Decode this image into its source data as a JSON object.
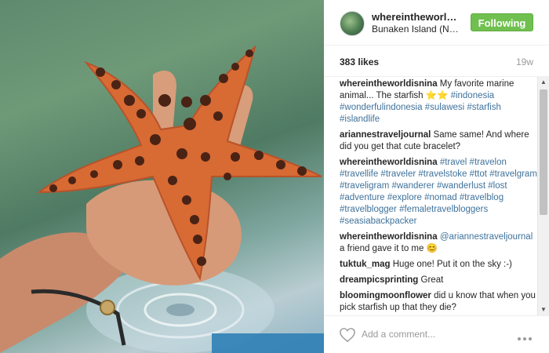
{
  "post": {
    "username": "whereintheworldisnina",
    "location": "Bunaken Island (North Sulawesi)",
    "follow_label": "Following",
    "likes": "383 likes",
    "age": "19w"
  },
  "comments": [
    {
      "user": "whereintheworldisnina",
      "parts": [
        {
          "type": "text",
          "text": " My favorite marine animal... The starfish ⭐⭐ "
        },
        {
          "type": "tag",
          "text": "#indonesia"
        },
        {
          "type": "text",
          "text": " "
        },
        {
          "type": "tag",
          "text": "#wonderfulindonesia"
        },
        {
          "type": "text",
          "text": " "
        },
        {
          "type": "tag",
          "text": "#sulawesi"
        },
        {
          "type": "text",
          "text": " "
        },
        {
          "type": "tag",
          "text": "#starfish"
        },
        {
          "type": "text",
          "text": " "
        },
        {
          "type": "tag",
          "text": "#islandlife"
        }
      ]
    },
    {
      "user": "ariannestraveljournal",
      "parts": [
        {
          "type": "text",
          "text": " Same same! And where did you get that cute bracelet?"
        }
      ]
    },
    {
      "user": "whereintheworldisnina",
      "parts": [
        {
          "type": "text",
          "text": " "
        },
        {
          "type": "tag",
          "text": "#travel"
        },
        {
          "type": "text",
          "text": " "
        },
        {
          "type": "tag",
          "text": "#travelon"
        },
        {
          "type": "text",
          "text": " "
        },
        {
          "type": "tag",
          "text": "#travellife"
        },
        {
          "type": "text",
          "text": " "
        },
        {
          "type": "tag",
          "text": "#traveler"
        },
        {
          "type": "text",
          "text": " "
        },
        {
          "type": "tag",
          "text": "#travelstoke"
        },
        {
          "type": "text",
          "text": " "
        },
        {
          "type": "tag",
          "text": "#ttot"
        },
        {
          "type": "text",
          "text": " "
        },
        {
          "type": "tag",
          "text": "#travelgram"
        },
        {
          "type": "text",
          "text": " "
        },
        {
          "type": "tag",
          "text": "#traveligram"
        },
        {
          "type": "text",
          "text": " "
        },
        {
          "type": "tag",
          "text": "#wanderer"
        },
        {
          "type": "text",
          "text": " "
        },
        {
          "type": "tag",
          "text": "#wanderlust"
        },
        {
          "type": "text",
          "text": " "
        },
        {
          "type": "tag",
          "text": "#lost"
        },
        {
          "type": "text",
          "text": " "
        },
        {
          "type": "tag",
          "text": "#adventure"
        },
        {
          "type": "text",
          "text": " "
        },
        {
          "type": "tag",
          "text": "#explore"
        },
        {
          "type": "text",
          "text": " "
        },
        {
          "type": "tag",
          "text": "#nomad"
        },
        {
          "type": "text",
          "text": " "
        },
        {
          "type": "tag",
          "text": "#travelblog"
        },
        {
          "type": "text",
          "text": " "
        },
        {
          "type": "tag",
          "text": "#travelblogger"
        },
        {
          "type": "text",
          "text": " "
        },
        {
          "type": "tag",
          "text": "#femaletravelbloggers"
        },
        {
          "type": "text",
          "text": " "
        },
        {
          "type": "tag",
          "text": "#seasiabackpacker"
        }
      ]
    },
    {
      "user": "whereintheworldisnina",
      "parts": [
        {
          "type": "text",
          "text": " "
        },
        {
          "type": "mention",
          "text": "@ariannestraveljournal"
        },
        {
          "type": "text",
          "text": " a friend gave it to me 😊"
        }
      ]
    },
    {
      "user": "tuktuk_mag",
      "parts": [
        {
          "type": "text",
          "text": " Huge one! Put it on the sky :-)"
        }
      ]
    },
    {
      "user": "dreampicsprinting",
      "parts": [
        {
          "type": "text",
          "text": " Great"
        }
      ]
    },
    {
      "user": "bloomingmoonflower",
      "parts": [
        {
          "type": "text",
          "text": " did u know that when you pick starfish up that they die?"
        }
      ]
    }
  ],
  "footer": {
    "comment_placeholder": "Add a comment...",
    "like_icon": "heart-outline-icon",
    "more_icon": "more-options-icon"
  },
  "colors": {
    "follow_button": "#70c050",
    "hashtag": "#3f729b"
  }
}
